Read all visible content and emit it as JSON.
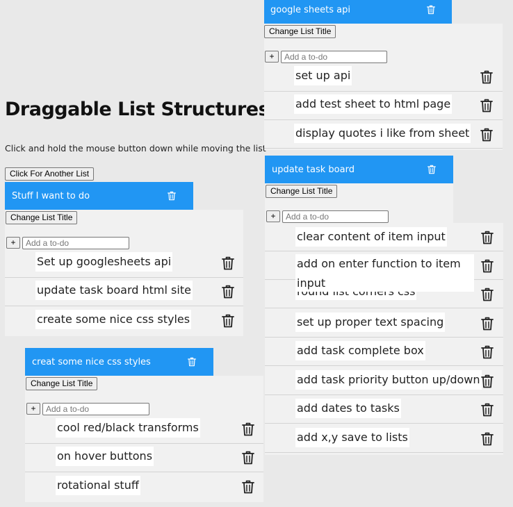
{
  "page": {
    "title": "Draggable List Structures",
    "subtitle": "Click and hold the mouse button down while moving the list",
    "another_list_label": "Click For Another List"
  },
  "common": {
    "change_title_label": "Change List Title",
    "plus_label": "+",
    "input_placeholder": "Add a to-do"
  },
  "lists": [
    {
      "title": "Stuff I want to do",
      "items": [
        "Set up googlesheets api",
        "update task board html site",
        "create some nice css styles"
      ]
    },
    {
      "title": "creat some nice css styles",
      "items": [
        "cool red/black transforms",
        "on hover buttons",
        "rotational stuff"
      ]
    },
    {
      "title": "google sheets api",
      "items": [
        "set up api",
        "add test sheet to html page",
        "display quotes i like from sheet"
      ]
    },
    {
      "title": "update task board",
      "items": [
        "clear content of item input",
        "add on enter function to item input",
        "round list corners css",
        "set up proper text spacing",
        "add task complete box",
        "add task priority button up/down",
        "add dates to tasks",
        "add x,y save to lists"
      ]
    }
  ],
  "colors": {
    "header": "#2196f3",
    "body": "#f1f1f1",
    "page": "#e9e9e9"
  },
  "icons": {
    "delete": "trash-icon"
  }
}
